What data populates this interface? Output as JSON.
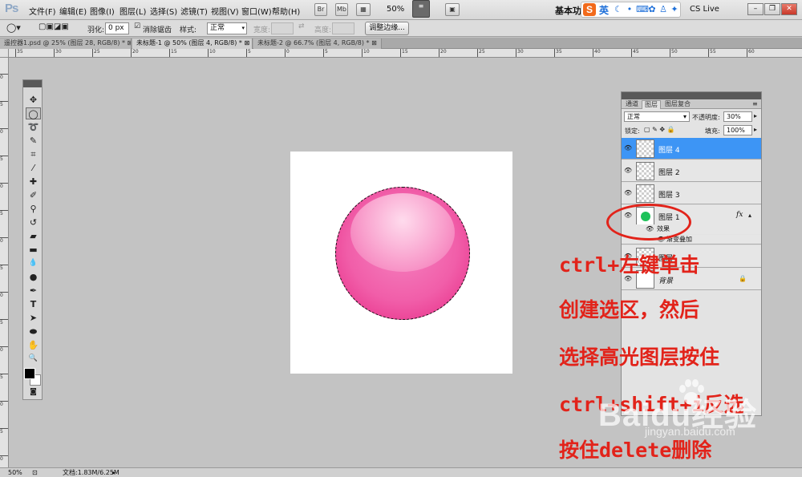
{
  "app": {
    "logo": "Ps"
  },
  "menu": [
    "文件(F)",
    "编辑(E)",
    "图像(I)",
    "图层(L)",
    "选择(S)",
    "滤镜(T)",
    "视图(V)",
    "窗口(W)",
    "帮助(H)"
  ],
  "menubar_buttons": {
    "bridge": "Br",
    "minibridge": "Mb"
  },
  "zoom": "50%",
  "workspace": "基本功能",
  "ime": {
    "lang": "英"
  },
  "cs_live": "CS Live",
  "options": {
    "feather_label": "羽化:",
    "feather_value": "0 px",
    "antialias_label": "消除锯齿",
    "style_label": "样式:",
    "style_value": "正常",
    "width_label": "宽度:",
    "height_label": "高度:",
    "refine_edge": "调整边缘..."
  },
  "doc_tabs": [
    {
      "label": "遥控器1.psd @ 25% (图层 28, RGB/8) *",
      "active": false
    },
    {
      "label": "未标题-1 @ 50% (图层 4, RGB/8) *",
      "active": true
    },
    {
      "label": "未标题-2 @ 66.7% (图层 4, RGB/8) *",
      "active": false
    }
  ],
  "ruler_top": [
    "35",
    "30",
    "25",
    "20",
    "15",
    "10",
    "5",
    "0",
    "5",
    "10",
    "15",
    "20",
    "25",
    "30",
    "35",
    "40",
    "45",
    "50",
    "55",
    "60"
  ],
  "ruler_left": [
    "0",
    "5",
    "0",
    "5",
    "0",
    "5",
    "0",
    "5",
    "0",
    "5",
    "0",
    "5",
    "0",
    "5",
    "0"
  ],
  "tools": [
    {
      "icon": "move-icon",
      "glyph": "✥"
    },
    {
      "icon": "marquee-elliptical-icon",
      "glyph": "◯"
    },
    {
      "icon": "lasso-icon",
      "glyph": "➰"
    },
    {
      "icon": "quick-select-icon",
      "glyph": "✎"
    },
    {
      "icon": "crop-icon",
      "glyph": "⌗"
    },
    {
      "icon": "eyedropper-icon",
      "glyph": "⁄"
    },
    {
      "icon": "healing-brush-icon",
      "glyph": "✚"
    },
    {
      "icon": "brush-icon",
      "glyph": "✐"
    },
    {
      "icon": "clone-stamp-icon",
      "glyph": "⚲"
    },
    {
      "icon": "history-brush-icon",
      "glyph": "↺"
    },
    {
      "icon": "eraser-icon",
      "glyph": "▰"
    },
    {
      "icon": "gradient-icon",
      "glyph": "▬"
    },
    {
      "icon": "blur-icon",
      "glyph": "💧"
    },
    {
      "icon": "dodge-icon",
      "glyph": "●"
    },
    {
      "icon": "pen-icon",
      "glyph": "✒"
    },
    {
      "icon": "type-icon",
      "glyph": "T"
    },
    {
      "icon": "path-select-icon",
      "glyph": "➤"
    },
    {
      "icon": "ellipse-shape-icon",
      "glyph": "⬬"
    },
    {
      "icon": "hand-icon",
      "glyph": "✋"
    },
    {
      "icon": "zoom-icon",
      "glyph": "🔍"
    }
  ],
  "layers_panel": {
    "tabs": [
      "通道",
      "图层",
      "图层复合"
    ],
    "blend_mode": "正常",
    "opacity_label": "不透明度:",
    "opacity": "30%",
    "lock_label": "锁定:",
    "fill_label": "填充:",
    "fill": "100%",
    "layers": [
      {
        "name": "图层 4",
        "selected": true
      },
      {
        "name": "图层 2",
        "selected": false
      },
      {
        "name": "图层 3",
        "selected": false
      },
      {
        "name": "图层 1",
        "selected": false,
        "fx": "fx"
      },
      {
        "name": "图层",
        "selected": false
      },
      {
        "name": "背景",
        "selected": false
      }
    ],
    "effects_label": "效果",
    "effect_item": "渐变叠加"
  },
  "annotation": {
    "line1": "ctrl+左键单击",
    "line2": "创建选区，然后",
    "line3": "选择高光图层按住",
    "line4": "ctrl+shift+i反选",
    "line5": "按住delete删除"
  },
  "watermark": {
    "main": "Baidu经验",
    "sub": "jingyan.baidu.com"
  },
  "status": {
    "zoom": "50%",
    "doc": "文档:1.83M/6.25M"
  },
  "colors": {
    "pink_ball": "#f15ea9",
    "annotation_red": "#e2231a",
    "selection_blue": "#3d95f5",
    "green_dot": "#1ec25a"
  }
}
